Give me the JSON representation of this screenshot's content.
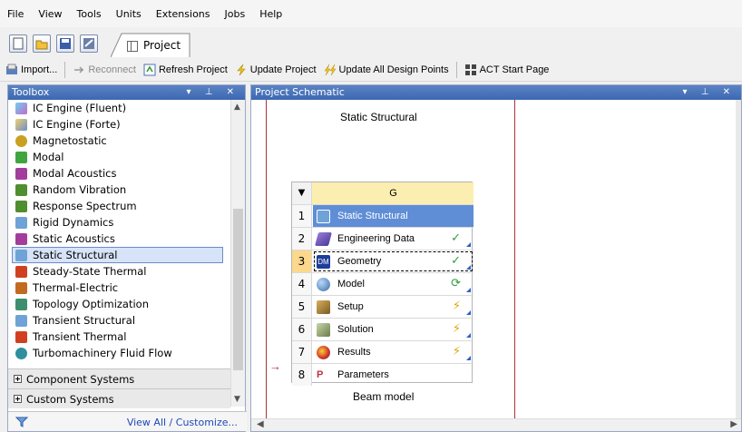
{
  "menu": [
    "File",
    "View",
    "Tools",
    "Units",
    "Extensions",
    "Jobs",
    "Help"
  ],
  "tabs": {
    "project": "Project"
  },
  "toolbar": {
    "import": "Import...",
    "reconnect": "Reconnect",
    "refresh": "Refresh Project",
    "update": "Update Project",
    "update_all": "Update All Design Points",
    "act": "ACT Start Page"
  },
  "toolbox": {
    "title": "Toolbox",
    "items": [
      "IC Engine (Fluent)",
      "IC Engine (Forte)",
      "Magnetostatic",
      "Modal",
      "Modal Acoustics",
      "Random Vibration",
      "Response Spectrum",
      "Rigid Dynamics",
      "Static Acoustics",
      "Static Structural",
      "Steady-State Thermal",
      "Thermal-Electric",
      "Topology Optimization",
      "Transient Structural",
      "Transient Thermal",
      "Turbomachinery Fluid Flow"
    ],
    "selected": "Static Structural",
    "groups": [
      "Component Systems",
      "Custom Systems"
    ],
    "footer_link": "View All / Customize..."
  },
  "schematic": {
    "title": "Project Schematic",
    "upper_label": "Static Structural",
    "system": {
      "column": "G",
      "name": "Static Structural",
      "caption": "Beam model",
      "rows": [
        {
          "n": "2",
          "label": "Engineering Data",
          "status": "✓"
        },
        {
          "n": "3",
          "label": "Geometry",
          "status": "✓"
        },
        {
          "n": "4",
          "label": "Model",
          "status": "⟳"
        },
        {
          "n": "5",
          "label": "Setup",
          "status": "⚡"
        },
        {
          "n": "6",
          "label": "Solution",
          "status": "⚡"
        },
        {
          "n": "7",
          "label": "Results",
          "status": "⚡"
        },
        {
          "n": "8",
          "label": "Parameters",
          "status": ""
        }
      ],
      "title_row_num": "1",
      "header_symbol": "▼",
      "param_arrow": "→"
    }
  },
  "colors": {
    "panel_title": "#3c68b2",
    "selected_row": "#5f8ed6",
    "header_row": "#fbeeb0",
    "link_line": "#a8323a"
  }
}
